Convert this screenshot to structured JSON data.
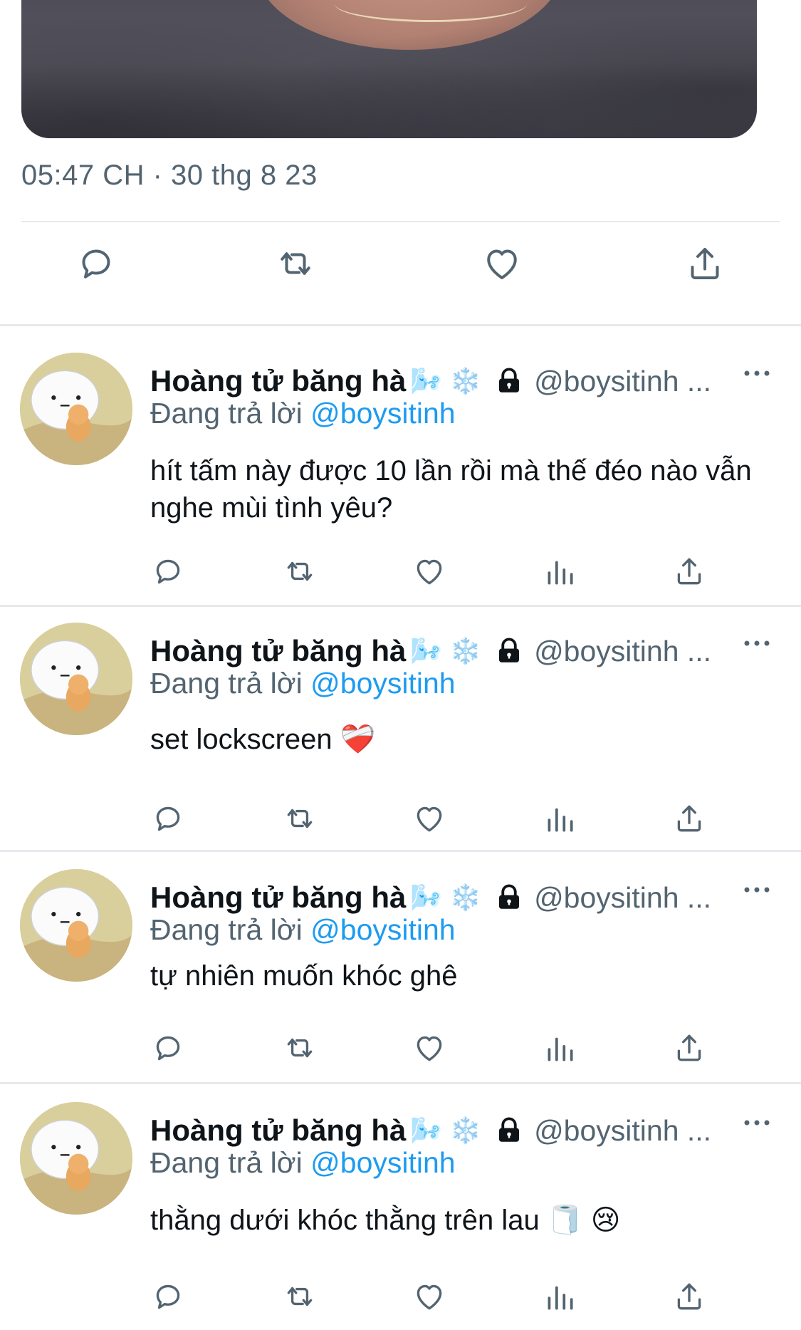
{
  "main_tweet": {
    "timestamp": "05:47 CH · 30 thg 8 23",
    "actions": [
      "reply-icon",
      "retweet-icon",
      "like-icon",
      "share-icon"
    ]
  },
  "replies": [
    {
      "name": "Hoàng tử băng hà",
      "name_emojis": "🌬️ ❄️",
      "handle": "@boysitinh ...",
      "replying_label": "Đang trả lời",
      "replying_to": "@boysitinh",
      "text": "hít tấm này được 10 lần rồi mà thế đéo nào vẫn nghe mùi tình yêu?"
    },
    {
      "name": "Hoàng tử băng hà",
      "name_emojis": "🌬️ ❄️",
      "handle": "@boysitinh ...",
      "replying_label": "Đang trả lời",
      "replying_to": "@boysitinh",
      "text": "set lockscreen ❤️‍🩹"
    },
    {
      "name": "Hoàng tử băng hà",
      "name_emojis": "🌬️ ❄️",
      "handle": "@boysitinh ...",
      "replying_label": "Đang trả lời",
      "replying_to": "@boysitinh",
      "text": "tự nhiên muốn khóc ghê"
    },
    {
      "name": "Hoàng tử băng hà",
      "name_emojis": "🌬️ ❄️",
      "handle": "@boysitinh ...",
      "replying_label": "Đang trả lời",
      "replying_to": "@boysitinh",
      "text": "thằng dưới khóc thằng trên lau 🧻 😢"
    }
  ],
  "colors": {
    "accent": "#1d9bf0",
    "secondary_text": "#536471",
    "divider": "#e6e9ec"
  }
}
